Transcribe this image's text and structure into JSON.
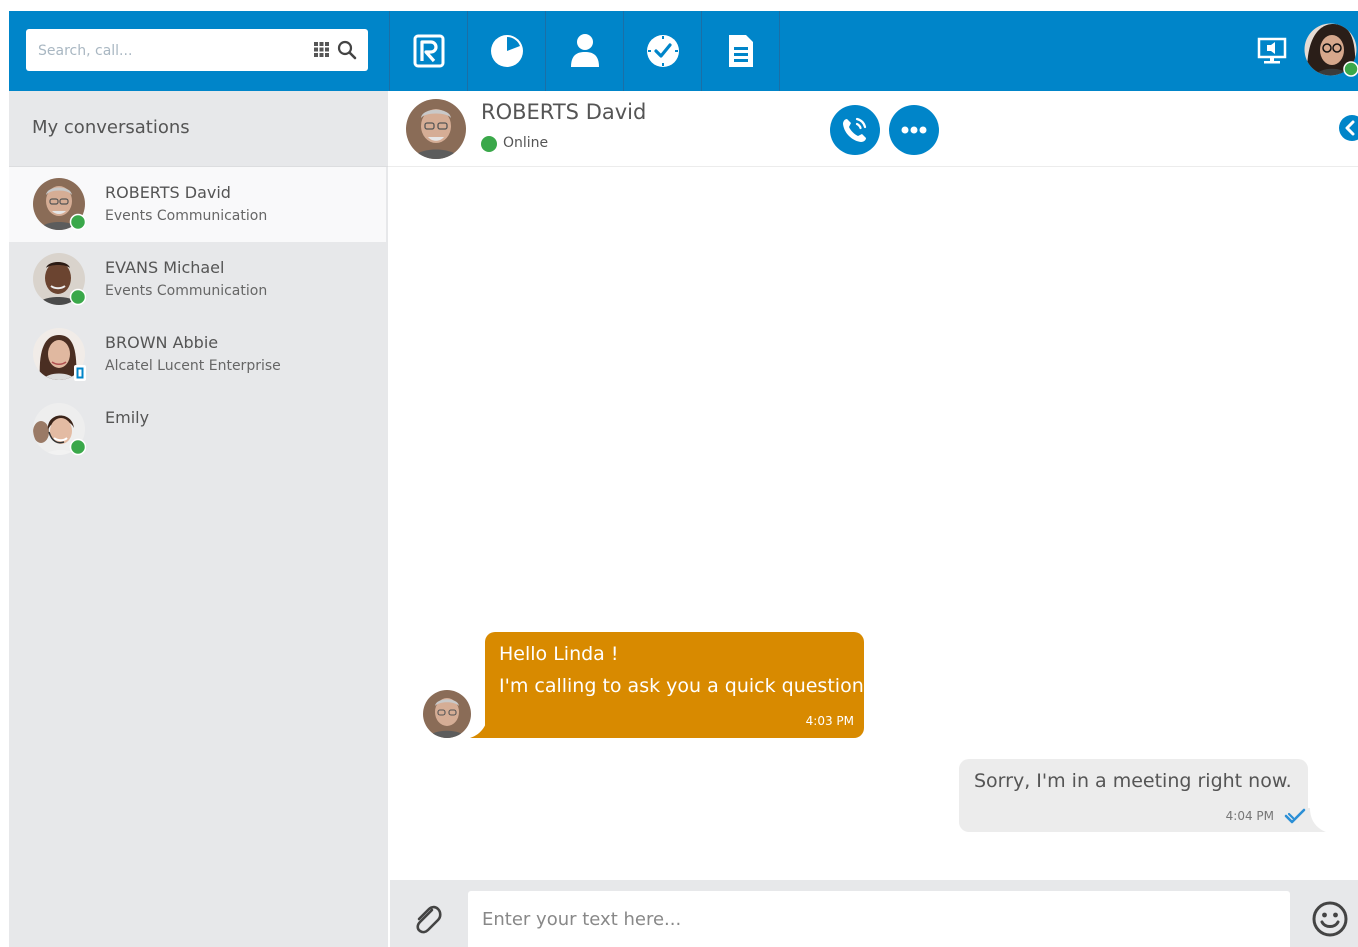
{
  "search": {
    "placeholder": "Search, call..."
  },
  "nav": [
    {
      "name": "rainbow-icon"
    },
    {
      "name": "recents-icon"
    },
    {
      "name": "contacts-icon"
    },
    {
      "name": "calendar-icon"
    },
    {
      "name": "documents-icon"
    }
  ],
  "sidebar": {
    "title": "My conversations",
    "conversations": [
      {
        "name": "ROBERTS David",
        "company": "Events Communication",
        "presence": "online"
      },
      {
        "name": "EVANS Michael",
        "company": "Events Communication",
        "presence": "online"
      },
      {
        "name": "BROWN Abbie",
        "company": "Alcatel Lucent Enterprise",
        "presence": "mobile"
      },
      {
        "name": "Emily",
        "company": "",
        "presence": "online"
      }
    ]
  },
  "chat": {
    "contact_name": "ROBERTS David",
    "status": "Online",
    "messages": [
      {
        "direction": "in",
        "line1": "Hello Linda !",
        "line2": "I'm calling to ask you a quick question",
        "time": "4:03 PM"
      },
      {
        "direction": "out",
        "line1": "Sorry, I'm in a meeting right now.",
        "time": "4:04 PM"
      }
    ]
  },
  "composer": {
    "placeholder": "Enter your text here..."
  },
  "colors": {
    "brand": "#0085c9",
    "incoming_bubble": "#d88a00",
    "outgoing_bubble": "#ececec",
    "online": "#3aa84a",
    "sidebar_bg": "#e7e8ea"
  }
}
